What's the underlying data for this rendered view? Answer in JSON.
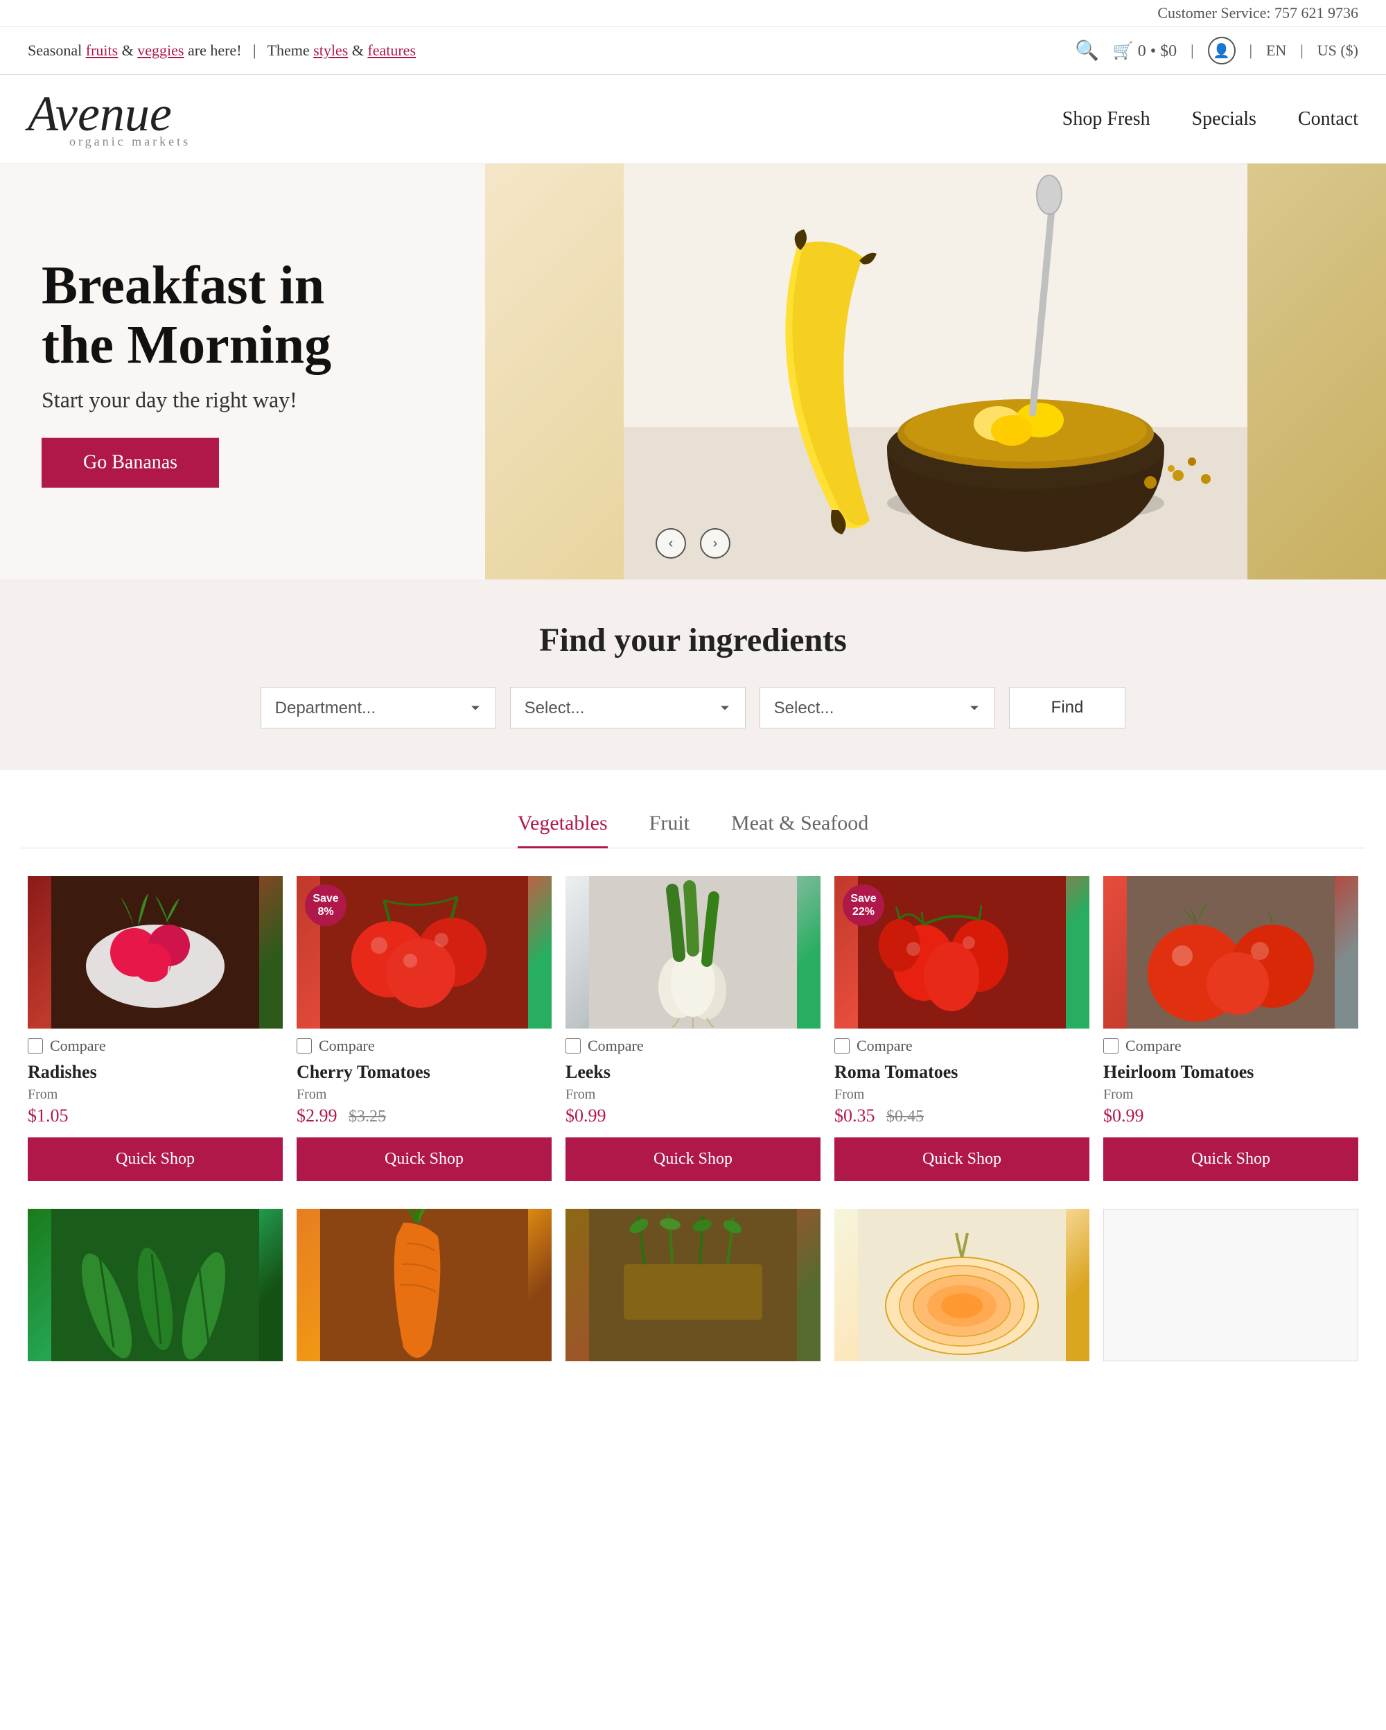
{
  "topbar": {
    "customer_service": "Customer Service: 757 621 9736"
  },
  "announcement": {
    "text_before": "Seasonal ",
    "link1": "fruits",
    "text_mid": " & ",
    "link2": "veggies",
    "text_after": " are here!",
    "divider": "|",
    "theme_text": "Theme ",
    "styles_link": "styles",
    "and": " & ",
    "features_link": "features"
  },
  "nav": {
    "cart_count": "0",
    "cart_price": "$0",
    "lang": "EN",
    "currency": "US ($)",
    "links": [
      {
        "label": "Shop Fresh",
        "id": "shop-fresh"
      },
      {
        "label": "Specials",
        "id": "specials"
      },
      {
        "label": "Contact",
        "id": "contact"
      }
    ]
  },
  "logo": {
    "text": "Avenue",
    "sub": "organic markets"
  },
  "hero": {
    "title": "Breakfast in the Morning",
    "subtitle": "Start your day the right way!",
    "cta_label": "Go Bananas"
  },
  "hero_arrows": {
    "prev": "‹",
    "next": "›"
  },
  "find": {
    "title": "Find your ingredients",
    "department_placeholder": "Department...",
    "select1_placeholder": "Select...",
    "select2_placeholder": "Select...",
    "find_btn": "Find"
  },
  "tabs": [
    {
      "label": "Vegetables",
      "active": true
    },
    {
      "label": "Fruit",
      "active": false
    },
    {
      "label": "Meat & Seafood",
      "active": false
    }
  ],
  "products": [
    {
      "id": "radishes",
      "name": "Radishes",
      "from_label": "From",
      "price": "$1.05",
      "orig_price": null,
      "save_pct": null,
      "img_class": "img-radishes",
      "quick_shop": "Quick Shop"
    },
    {
      "id": "cherry-tomatoes",
      "name": "Cherry Tomatoes",
      "from_label": "From",
      "price": "$2.99",
      "orig_price": "$3.25",
      "save_pct": "8%",
      "img_class": "img-cherry-tomatoes",
      "quick_shop": "Quick Shop"
    },
    {
      "id": "leeks",
      "name": "Leeks",
      "from_label": "From",
      "price": "$0.99",
      "orig_price": null,
      "save_pct": null,
      "img_class": "img-leeks",
      "quick_shop": "Quick Shop"
    },
    {
      "id": "roma-tomatoes",
      "name": "Roma Tomatoes",
      "from_label": "From",
      "price": "$0.35",
      "orig_price": "$0.45",
      "save_pct": "22%",
      "img_class": "img-roma-tomatoes",
      "quick_shop": "Quick Shop"
    },
    {
      "id": "heirloom-tomatoes",
      "name": "Heirloom Tomatoes",
      "from_label": "From",
      "price": "$0.99",
      "orig_price": null,
      "save_pct": null,
      "img_class": "img-heirloom-tomatoes",
      "quick_shop": "Quick Shop"
    }
  ],
  "products_row2": [
    {
      "id": "zucchini",
      "img_class": "img-zucchini"
    },
    {
      "id": "carrot",
      "img_class": "img-carrot"
    },
    {
      "id": "misc1",
      "img_class": "img-misc1"
    },
    {
      "id": "onion",
      "img_class": "img-onion"
    },
    {
      "id": "white",
      "img_class": "img-white"
    }
  ],
  "compare_label": "Compare"
}
